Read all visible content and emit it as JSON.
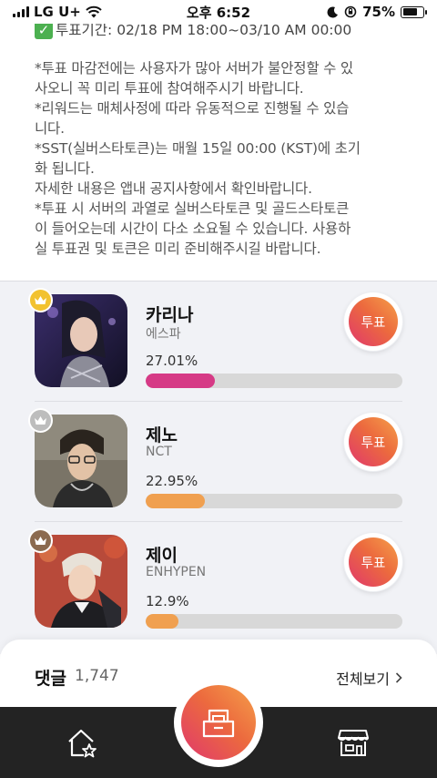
{
  "status_bar": {
    "carrier": "LG U+",
    "time": "오후 6:52",
    "battery": "75%",
    "battery_level": 0.75
  },
  "notice": {
    "period": "투표기간: 02/18 PM 18:00~03/10 AM 00:00",
    "text": "*투표 마감전에는 사용자가 많아 서버가 불안정할 수 있\n사오니 꼭 미리 투표에 참여해주시기 바랍니다.\n*리워드는 매체사정에 따라 유동적으로 진행될 수 있습\n니다.\n*SST(실버스타토큰)는 매월 15일 00:00 (KST)에 초기\n화 됩니다.\n자세한 내용은 앱내 공지사항에서 확인바랍니다.\n*투표 시 서버의 과열로 실버스타토큰 및 골드스타토큰\n이 들어오는데 시간이 다소 소요될 수 있습니다. 사용하\n실 투표권 및 토큰은 미리 준비해주시길 바랍니다."
  },
  "candidates": [
    {
      "rank": 1,
      "name": "카리나",
      "group": "에스파",
      "percent_label": "27.01%",
      "percent": 27.01,
      "bar_color": "#d63a86",
      "crown_color": "#f2c230",
      "vote_label": "투표"
    },
    {
      "rank": 2,
      "name": "제노",
      "group": "NCT",
      "percent_label": "22.95%",
      "percent": 22.95,
      "bar_color": "#f0a050",
      "crown_color": "#bdbdbd",
      "vote_label": "투표"
    },
    {
      "rank": 3,
      "name": "제이",
      "group": "ENHYPEN",
      "percent_label": "12.9%",
      "percent": 12.9,
      "bar_color": "#f0a050",
      "crown_color": "#8b6a4f",
      "vote_label": "투표"
    }
  ],
  "comments": {
    "title": "댓글",
    "count": "1,747",
    "view_all": "전체보기"
  },
  "nav": {
    "left_icon": "home-star-icon",
    "center_icon": "ballot-box-icon",
    "right_icon": "store-icon"
  },
  "colors": {
    "accent_start": "#f5a04a",
    "accent_end": "#e0386d",
    "nav_background": "#232323",
    "list_background": "#f1f2f6"
  }
}
